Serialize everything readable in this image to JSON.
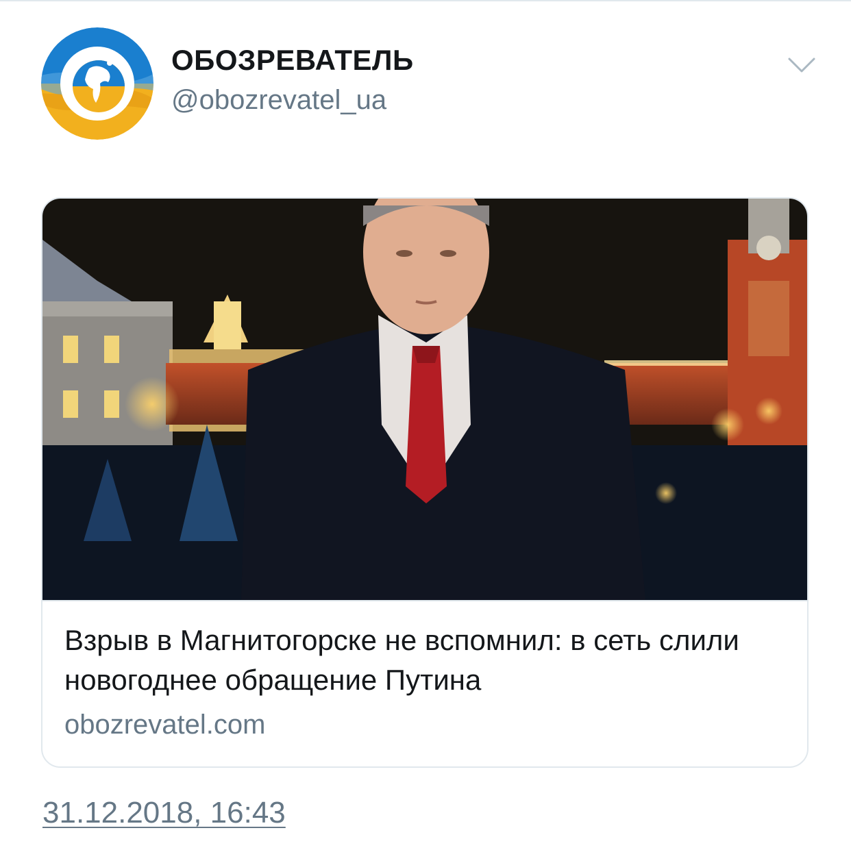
{
  "tweet": {
    "display_name": "ОБОЗРЕВАТЕЛЬ",
    "handle": "@obozrevatel_ua",
    "menu_icon": "chevron-down-icon",
    "avatar_icon": "globe-logo-icon",
    "timestamp": "31.12.2018, 16:43"
  },
  "card": {
    "title": "Взрыв в Магнитогорске не вспомнил: в сеть слили новогоднее обращение Путина",
    "domain": "obozrevatel.com"
  },
  "colors": {
    "text_primary": "#14171a",
    "text_secondary": "#657786",
    "border": "#e1e8ed",
    "logo_blue": "#1a7fcf",
    "logo_yellow": "#f2b01e"
  }
}
